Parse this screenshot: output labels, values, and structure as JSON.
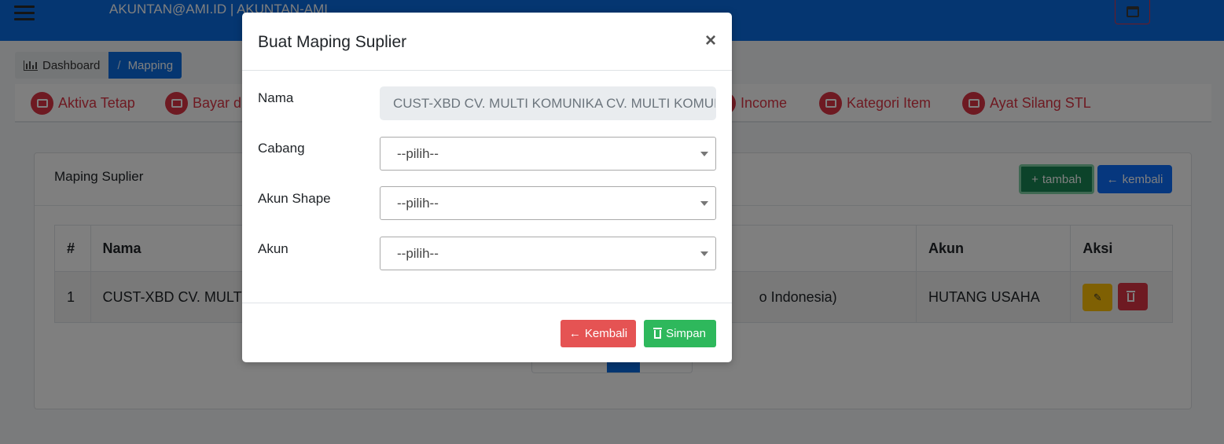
{
  "header": {
    "user_label": "AKUNTAN@AMI.ID | AKUNTAN-AMI"
  },
  "breadcrumb": {
    "items": [
      {
        "label": "Dashboard",
        "icon": "bar-chart-icon"
      },
      {
        "label": "Mapping",
        "icon": ""
      }
    ],
    "separator": "/"
  },
  "module_menu": {
    "items": [
      {
        "label": "Aktiva Tetap",
        "icon": "factory-icon"
      },
      {
        "label": "Bayar di",
        "icon": "wallet-icon"
      },
      {
        "label": "Income",
        "icon": "wallet-icon"
      },
      {
        "label": "Kategori Item",
        "icon": "checkbox-icon"
      },
      {
        "label": "Ayat Silang STL",
        "icon": "wallet-icon"
      }
    ],
    "accent_color": "#dc3545"
  },
  "card": {
    "title": "Maping Suplier",
    "tambah_label": "tambah",
    "kembali_label": "kembali",
    "table": {
      "headers": [
        "#",
        "Nama",
        "Akun",
        "Aksi"
      ],
      "rows": [
        {
          "no": "1",
          "nama": "CUST-XBD CV. MULTI K",
          "middle": "o Indonesia)",
          "akun": "HUTANG USAHA"
        }
      ]
    }
  },
  "modal": {
    "title": "Buat Maping Suplier",
    "close_symbol": "×",
    "fields": {
      "nama": {
        "label": "Nama",
        "value": "CUST-XBD  CV. MULTI KOMUNIKA CV. MULTI KOMUNIKA"
      },
      "cabang": {
        "label": "Cabang",
        "value": "--pilih--"
      },
      "akun_shape": {
        "label": "Akun Shape",
        "value": "--pilih--"
      },
      "akun": {
        "label": "Akun",
        "value": "--pilih--"
      }
    },
    "kembali_label": "Kembali",
    "simpan_label": "Simpan"
  },
  "colors": {
    "topbar": "#0b6de3",
    "success": "#2eb85c",
    "danger": "#e55353",
    "warning": "#ffc107"
  }
}
